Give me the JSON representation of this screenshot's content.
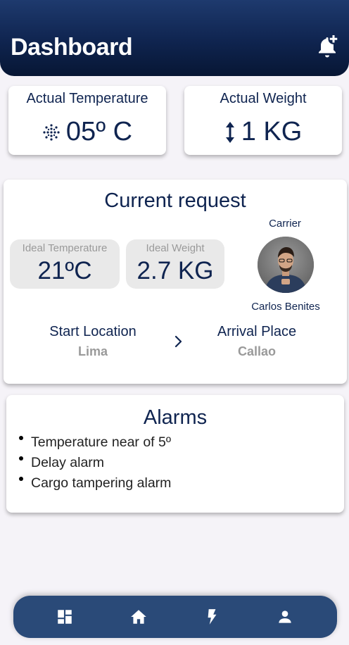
{
  "header": {
    "title": "Dashboard"
  },
  "metrics": {
    "temperature": {
      "label": "Actual Temperature",
      "value": "05º C",
      "icon": "snowflake-dots-icon"
    },
    "weight": {
      "label": "Actual Weight",
      "value": "1 KG",
      "icon": "vertical-arrows-icon"
    }
  },
  "request": {
    "title": "Current request",
    "ideal_temperature": {
      "label": "Ideal Temperature",
      "value": "21ºC"
    },
    "ideal_weight": {
      "label": "Ideal Weight",
      "value": "2.7 KG"
    },
    "carrier": {
      "label": "Carrier",
      "name": "Carlos Benites"
    },
    "start": {
      "label": "Start Location",
      "value": "Lima"
    },
    "arrival": {
      "label": "Arrival Place",
      "value": "Callao"
    }
  },
  "alarms": {
    "title": "Alarms",
    "items": [
      "Temperature near of 5º",
      "Delay alarm",
      "Cargo tampering alarm"
    ]
  },
  "nav": {
    "items": [
      {
        "name": "dashboard",
        "icon": "dashboard-icon"
      },
      {
        "name": "home",
        "icon": "home-icon"
      },
      {
        "name": "flash",
        "icon": "lightning-icon"
      },
      {
        "name": "profile",
        "icon": "person-icon"
      }
    ]
  },
  "colors": {
    "primary": "#0f2450",
    "navbar": "#2a4a78",
    "background": "#f5f3f8"
  }
}
